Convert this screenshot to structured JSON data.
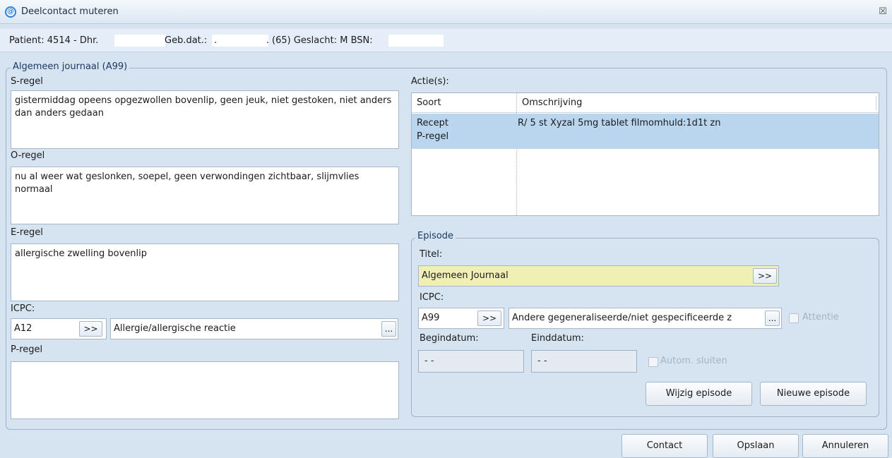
{
  "window": {
    "title": "Deelcontact muteren",
    "close_glyph": "☒"
  },
  "patient": {
    "prefix": "Patient: 4514 - Dhr.",
    "gebdat_label": "Geb.dat.:",
    "gebdat_dot1": ".",
    "gebdat_dot2": ".",
    "age_geslacht": "(65) Geslacht: M BSN:"
  },
  "journaal": {
    "legend": "Algemeen journaal (A99)",
    "s_label": "S-regel",
    "s_text": "gistermiddag opeens opgezwollen bovenlip, geen jeuk, niet gestoken, niet anders dan anders gedaan",
    "o_label": "O-regel",
    "o_text": "nu al weer wat geslonken, soepel, geen verwondingen zichtbaar, slijmvlies normaal",
    "e_label": "E-regel",
    "e_text": "allergische zwelling bovenlip",
    "icpc_label": "ICPC:",
    "icpc_code": "A12",
    "icpc_btn": ">>",
    "icpc_desc": "Allergie/allergische reactie",
    "icpc_more": "...",
    "p_label": "P-regel",
    "p_text": ""
  },
  "acties": {
    "label": "Actie(s):",
    "columns": [
      "Soort",
      "Omschrijving"
    ],
    "rows": [
      {
        "soort_line1": "Recept",
        "soort_line2": "P-regel",
        "omschrijving": "R/ 5 st Xyzal 5mg tablet filmomhuld:1d1t zn",
        "selected": true
      }
    ]
  },
  "episode": {
    "legend": "Episode",
    "titel_label": "Titel:",
    "titel_value": "Algemeen Journaal",
    "titel_btn": ">>",
    "icpc_label": "ICPC:",
    "icpc_code": "A99",
    "icpc_btn": ">>",
    "icpc_desc": "Andere gegeneraliseerde/niet gespecificeerde z",
    "icpc_more": "...",
    "attentie": "Attentie",
    "begindatum_label": "Begindatum:",
    "begindatum_value": "- -",
    "einddatum_label": "Einddatum:",
    "einddatum_value": "- -",
    "autom_sluiten": "Autom. sluiten",
    "wijzig_btn": "Wijzig episode",
    "nieuwe_btn": "Nieuwe episode"
  },
  "footer": {
    "contact": "Contact",
    "opslaan": "Opslaan",
    "annuleren": "Annuleren"
  },
  "colors": {
    "selected_row": "#b9d6ee",
    "titel_bg": "#f1f0b4",
    "accent": "#2f7fd6"
  }
}
